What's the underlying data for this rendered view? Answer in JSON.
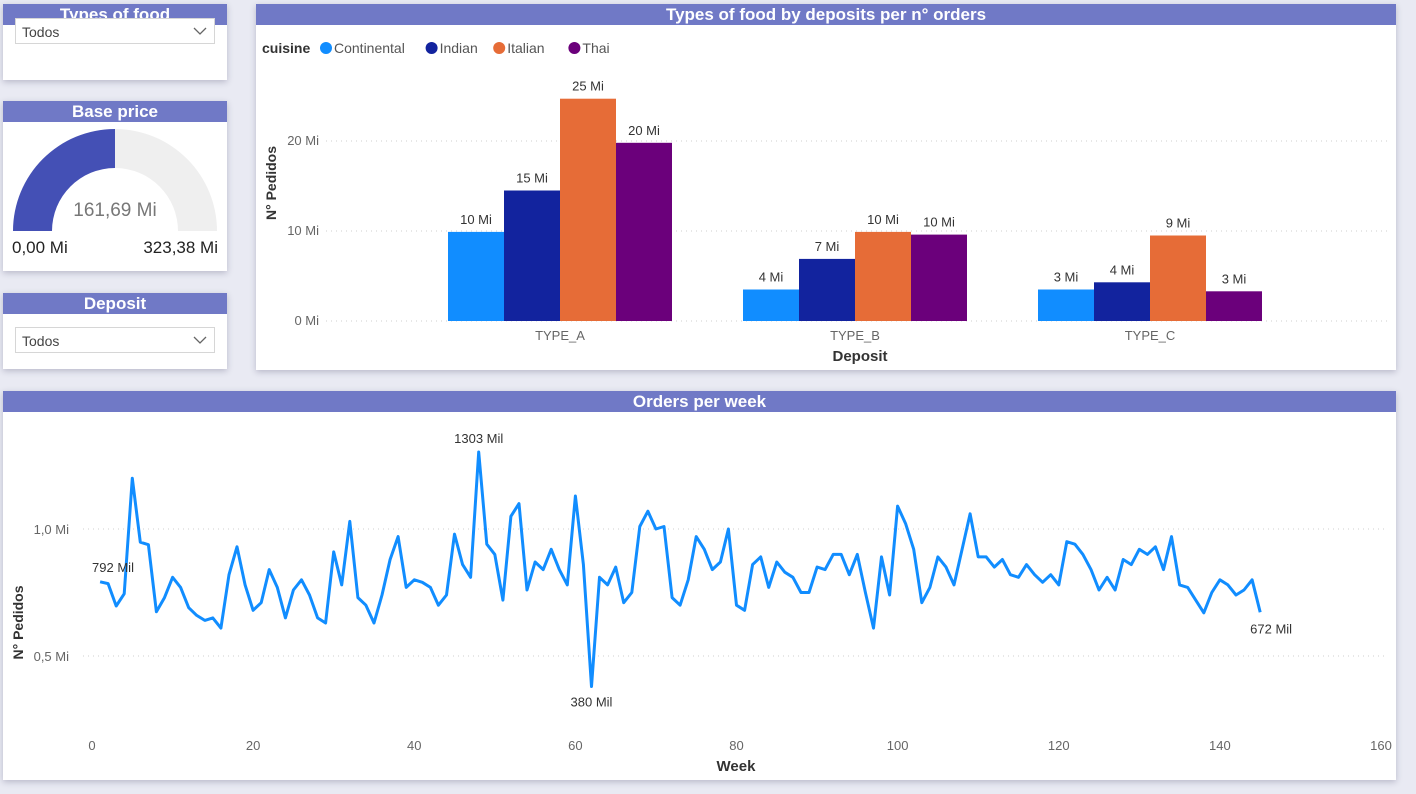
{
  "filters": {
    "food_title": "Types of food",
    "food_value": "Todos",
    "deposit_title": "Deposit",
    "deposit_value": "Todos"
  },
  "gauge": {
    "title": "Base price",
    "value_label": "161,69 Mi",
    "min_label": "0,00 Mi",
    "max_label": "323,38 Mi",
    "value": 161.69,
    "min": 0,
    "max": 323.38,
    "fill_color": "#4450b5",
    "track_color": "#efefef"
  },
  "chart_data": [
    {
      "type": "bar",
      "title": "Types of food by deposits per n° orders",
      "legend_title": "cuisine",
      "legend_position": "top-left",
      "xlabel": "Deposit",
      "ylabel": "N° Pedidos",
      "categories": [
        "TYPE_A",
        "TYPE_B",
        "TYPE_C"
      ],
      "ylim": [
        0,
        25
      ],
      "yticks": [
        0,
        10,
        20
      ],
      "ytick_labels": [
        "0 Mi",
        "10 Mi",
        "20 Mi"
      ],
      "grid": true,
      "series": [
        {
          "name": "Continental",
          "color": "#118dff",
          "values": [
            9.9,
            3.5,
            3.5
          ],
          "labels": [
            "10 Mi",
            "4 Mi",
            "3 Mi"
          ]
        },
        {
          "name": "Indian",
          "color": "#12239e",
          "values": [
            14.5,
            6.9,
            4.3
          ],
          "labels": [
            "15 Mi",
            "7 Mi",
            "4 Mi"
          ]
        },
        {
          "name": "Italian",
          "color": "#e66c37",
          "values": [
            24.7,
            9.9,
            9.5
          ],
          "labels": [
            "25 Mi",
            "10 Mi",
            "9 Mi"
          ]
        },
        {
          "name": "Thai",
          "color": "#6b007b",
          "values": [
            19.8,
            9.6,
            3.3
          ],
          "labels": [
            "20 Mi",
            "10 Mi",
            "3 Mi"
          ]
        }
      ]
    },
    {
      "type": "line",
      "title": "Orders per week",
      "xlabel": "Week",
      "ylabel": "N° Pedidos",
      "xlim": [
        0,
        160
      ],
      "xticks": [
        0,
        20,
        40,
        60,
        80,
        100,
        120,
        140,
        160
      ],
      "yticks": [
        0.5,
        1.0
      ],
      "ytick_labels": [
        "0,5 Mi",
        "1,0 Mi"
      ],
      "ylim": [
        0.2,
        1.5
      ],
      "grid": true,
      "color": "#118dff",
      "annotations": [
        {
          "week": 1,
          "value": 0.792,
          "label": "792 Mil"
        },
        {
          "week": 48,
          "value": 1.303,
          "label": "1303 Mil"
        },
        {
          "week": 62,
          "value": 0.38,
          "label": "380 Mil"
        },
        {
          "week": 145,
          "value": 0.672,
          "label": "672 Mil"
        }
      ],
      "x": [
        1,
        2,
        3,
        4,
        5,
        6,
        7,
        8,
        9,
        10,
        11,
        12,
        13,
        14,
        15,
        16,
        17,
        18,
        19,
        20,
        21,
        22,
        23,
        24,
        25,
        26,
        27,
        28,
        29,
        30,
        31,
        32,
        33,
        34,
        35,
        36,
        37,
        38,
        39,
        40,
        41,
        42,
        43,
        44,
        45,
        46,
        47,
        48,
        49,
        50,
        51,
        52,
        53,
        54,
        55,
        56,
        57,
        58,
        59,
        60,
        61,
        62,
        63,
        64,
        65,
        66,
        67,
        68,
        69,
        70,
        71,
        72,
        73,
        74,
        75,
        76,
        77,
        78,
        79,
        80,
        81,
        82,
        83,
        84,
        85,
        86,
        87,
        88,
        89,
        90,
        91,
        92,
        93,
        94,
        95,
        96,
        97,
        98,
        99,
        100,
        101,
        102,
        103,
        104,
        105,
        106,
        107,
        108,
        109,
        110,
        111,
        112,
        113,
        114,
        115,
        116,
        117,
        118,
        119,
        120,
        121,
        122,
        123,
        124,
        125,
        126,
        127,
        128,
        129,
        130,
        131,
        132,
        133,
        134,
        135,
        136,
        137,
        138,
        139,
        140,
        141,
        142,
        143,
        144,
        145
      ],
      "values": [
        0.792,
        0.785,
        0.697,
        0.745,
        1.2,
        0.948,
        0.938,
        0.674,
        0.73,
        0.81,
        0.77,
        0.69,
        0.66,
        0.64,
        0.65,
        0.61,
        0.82,
        0.93,
        0.78,
        0.68,
        0.71,
        0.84,
        0.77,
        0.65,
        0.76,
        0.8,
        0.74,
        0.65,
        0.63,
        0.91,
        0.78,
        1.03,
        0.73,
        0.7,
        0.63,
        0.74,
        0.88,
        0.97,
        0.77,
        0.8,
        0.79,
        0.77,
        0.7,
        0.74,
        0.98,
        0.86,
        0.81,
        1.303,
        0.94,
        0.9,
        0.72,
        1.05,
        1.1,
        0.76,
        0.87,
        0.84,
        0.92,
        0.84,
        0.78,
        1.13,
        0.86,
        0.38,
        0.81,
        0.78,
        0.85,
        0.71,
        0.75,
        1.01,
        1.07,
        1.0,
        1.01,
        0.73,
        0.7,
        0.8,
        0.97,
        0.92,
        0.84,
        0.87,
        1.0,
        0.7,
        0.68,
        0.86,
        0.89,
        0.77,
        0.87,
        0.83,
        0.81,
        0.75,
        0.75,
        0.85,
        0.84,
        0.9,
        0.9,
        0.82,
        0.9,
        0.75,
        0.61,
        0.89,
        0.74,
        1.09,
        1.02,
        0.92,
        0.71,
        0.77,
        0.89,
        0.85,
        0.78,
        0.92,
        1.06,
        0.89,
        0.89,
        0.85,
        0.88,
        0.82,
        0.81,
        0.86,
        0.82,
        0.79,
        0.82,
        0.78,
        0.95,
        0.94,
        0.9,
        0.84,
        0.76,
        0.81,
        0.76,
        0.88,
        0.86,
        0.92,
        0.9,
        0.93,
        0.84,
        0.97,
        0.78,
        0.77,
        0.72,
        0.67,
        0.75,
        0.8,
        0.78,
        0.74,
        0.76,
        0.8,
        0.672
      ]
    }
  ]
}
